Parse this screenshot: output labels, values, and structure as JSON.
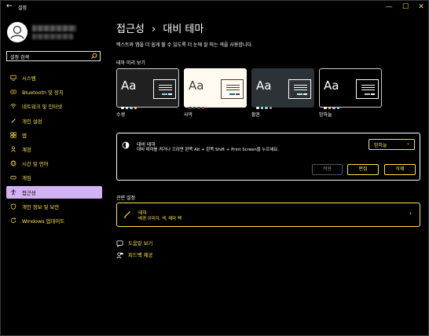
{
  "window": {
    "app_title": "설정",
    "controls": [
      "—",
      "☐",
      "✕"
    ]
  },
  "sidebar": {
    "search_placeholder": "설정 검색",
    "items": [
      {
        "label": "시스템",
        "icon": "monitor-icon",
        "active": false
      },
      {
        "label": "Bluetooth 및 장치",
        "icon": "bluetooth-icon",
        "active": false
      },
      {
        "label": "네트워크 및 인터넷",
        "icon": "wifi-icon",
        "active": false
      },
      {
        "label": "개인 설정",
        "icon": "pen-icon",
        "active": false
      },
      {
        "label": "앱",
        "icon": "apps-icon",
        "active": false
      },
      {
        "label": "계정",
        "icon": "person-icon",
        "active": false
      },
      {
        "label": "시간 및 언어",
        "icon": "globe-icon",
        "active": false
      },
      {
        "label": "게임",
        "icon": "gamepad-icon",
        "active": false
      },
      {
        "label": "접근성",
        "icon": "accessibility-icon",
        "active": true
      },
      {
        "label": "개인 정보 및 보안",
        "icon": "shield-icon",
        "active": false
      },
      {
        "label": "Windows 업데이트",
        "icon": "update-icon",
        "active": false
      }
    ]
  },
  "main": {
    "breadcrumb_parent": "접근성",
    "breadcrumb_sep": "›",
    "breadcrumb_current": "대비 테마",
    "subtitle": "텍스트와 앱을 더 쉽게 볼 수 있도록 더 눈에 잘 띄는 색을 사용합니다.",
    "preview_title": "테마 미리 보기",
    "themes": [
      {
        "name": "수생",
        "sample": "Aa"
      },
      {
        "name": "사막",
        "sample": "Aa"
      },
      {
        "name": "황혼",
        "sample": "Aa"
      },
      {
        "name": "밤하늘",
        "sample": "Aa"
      }
    ],
    "contrast": {
      "title": "대비 테마",
      "description": "대비 테마를 켜거나 끄려면 왼쪽 Alt + 왼쪽 Shift + Print Screen을 누르세요.",
      "selected": "밤하늘",
      "apply": "적용",
      "edit": "편집",
      "delete": "삭제"
    },
    "related_title": "관련 설정",
    "theme_link": {
      "title": "테마",
      "description": "배경 이미지, 색, 테마 팩"
    },
    "help": "도움말 보기",
    "feedback": "피드백 제공"
  },
  "colors": {
    "accent_yellow": "#ffe14a",
    "active_nav": "#d3b2f2"
  }
}
